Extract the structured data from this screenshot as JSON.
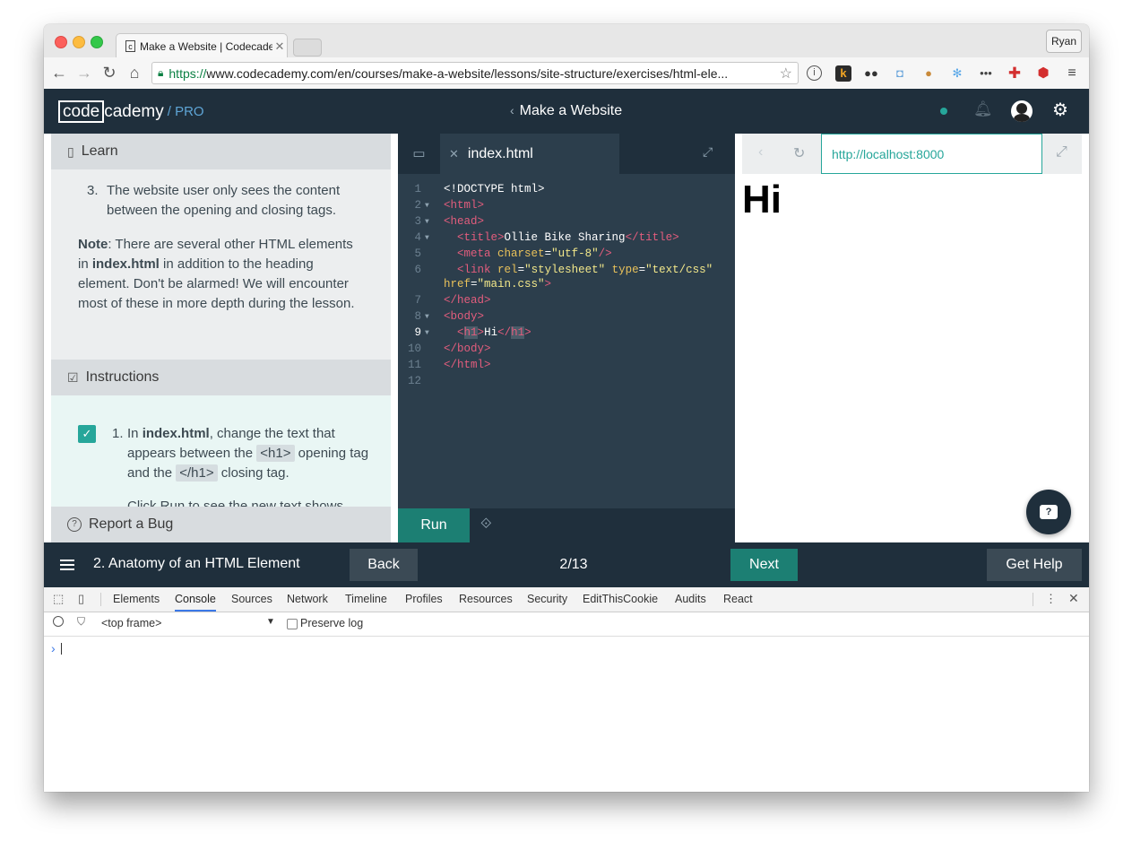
{
  "browser": {
    "tab_title": "Make a Website | Codecademy",
    "tab_favicon": "c",
    "profile_name": "Ryan",
    "url_https": "https://",
    "url_rest": "www.codecademy.com/en/courses/make-a-website/lessons/site-structure/exercises/html-ele..."
  },
  "header": {
    "logo_code": "code",
    "logo_cademy": "cademy",
    "logo_pro": "/ PRO",
    "course_title": "Make a Website"
  },
  "learn": {
    "heading": "Learn",
    "item3_number": "3.",
    "item3_text": "The website user only sees the content between the opening and closing tags.",
    "note_label": "Note",
    "note_text_1": ": There are several other HTML elements in ",
    "note_file": "index.html",
    "note_text_2": " in addition to the heading element. Don't be alarmed! We will encounter most of these in more depth during the lesson."
  },
  "instructions": {
    "heading": "Instructions",
    "step_number": "1.",
    "text_1": "In ",
    "file": "index.html",
    "text_2": ", change the text that appears between the ",
    "tag_open": "<h1>",
    "text_3": " opening tag and the ",
    "tag_close": "</h1>",
    "text_4": " closing tag.",
    "cut_text": "Click Run to see the new text shows"
  },
  "report_bug": "Report a Bug",
  "editor": {
    "filename": "index.html",
    "run_label": "Run",
    "lines": [
      {
        "n": "1",
        "fold": false
      },
      {
        "n": "2",
        "fold": true
      },
      {
        "n": "3",
        "fold": true
      },
      {
        "n": "4",
        "fold": true
      },
      {
        "n": "5",
        "fold": false
      },
      {
        "n": "6",
        "fold": false
      },
      {
        "n": "",
        "fold": false
      },
      {
        "n": "7",
        "fold": false
      },
      {
        "n": "8",
        "fold": true
      },
      {
        "n": "9",
        "fold": true
      },
      {
        "n": "10",
        "fold": false
      },
      {
        "n": "11",
        "fold": false
      },
      {
        "n": "12",
        "fold": false
      }
    ],
    "code": {
      "doctype": "<!DOCTYPE html>",
      "html_open": "<html>",
      "head_open": "<head>",
      "title_open": "<title>",
      "title_text": "Ollie Bike Sharing",
      "title_close": "</title>",
      "meta_tag": "<meta",
      "meta_attr": "charset",
      "meta_eq": "=",
      "meta_val": "\"utf-8\"",
      "meta_end": "/>",
      "link_tag": "<link",
      "link_rel": "rel",
      "link_rel_val": "\"stylesheet\"",
      "link_type": "type",
      "link_type_val": "\"text/css\"",
      "link_href": "href",
      "link_href_val": "\"main.css\"",
      "link_end": ">",
      "head_close": "</head>",
      "body_open": "<body>",
      "h1_lt": "<",
      "h1_name": "h1",
      "h1_gt": ">",
      "h1_text": "Hi",
      "h1_close_lt": "</",
      "h1_close_name": "h1",
      "h1_close_gt": ">",
      "body_close": "</body>",
      "html_close": "</html>"
    }
  },
  "preview": {
    "url": "http://localhost:8000",
    "h1": "Hi"
  },
  "navbar": {
    "lesson_title": "2. Anatomy of an HTML Element",
    "back_label": "Back",
    "progress": "2/13",
    "next_label": "Next",
    "help_label": "Get Help"
  },
  "devtools": {
    "tabs": [
      "Elements",
      "Console",
      "Sources",
      "Network",
      "Timeline",
      "Profiles",
      "Resources",
      "Security",
      "EditThisCookie",
      "Audits",
      "React"
    ],
    "active_tab": "Console",
    "frame": "<top frame>",
    "preserve_log": "Preserve log"
  },
  "colors": {
    "header_bg": "#1f2f3c",
    "accent": "#26a69a",
    "run_bg": "#1c7f73",
    "editor_bg": "#2c3e4c"
  },
  "icons": [
    "back-arrow-icon",
    "forward-arrow-icon",
    "reload-icon",
    "home-icon",
    "lock-icon",
    "star-icon",
    "info-icon",
    "green-dot-icon",
    "bell-icon",
    "avatar",
    "gear-icon",
    "book-icon",
    "checkbox-icon",
    "help-icon",
    "folder-icon",
    "close-icon",
    "expand-icon",
    "link-icon",
    "chat-icon",
    "hamburger-icon"
  ]
}
